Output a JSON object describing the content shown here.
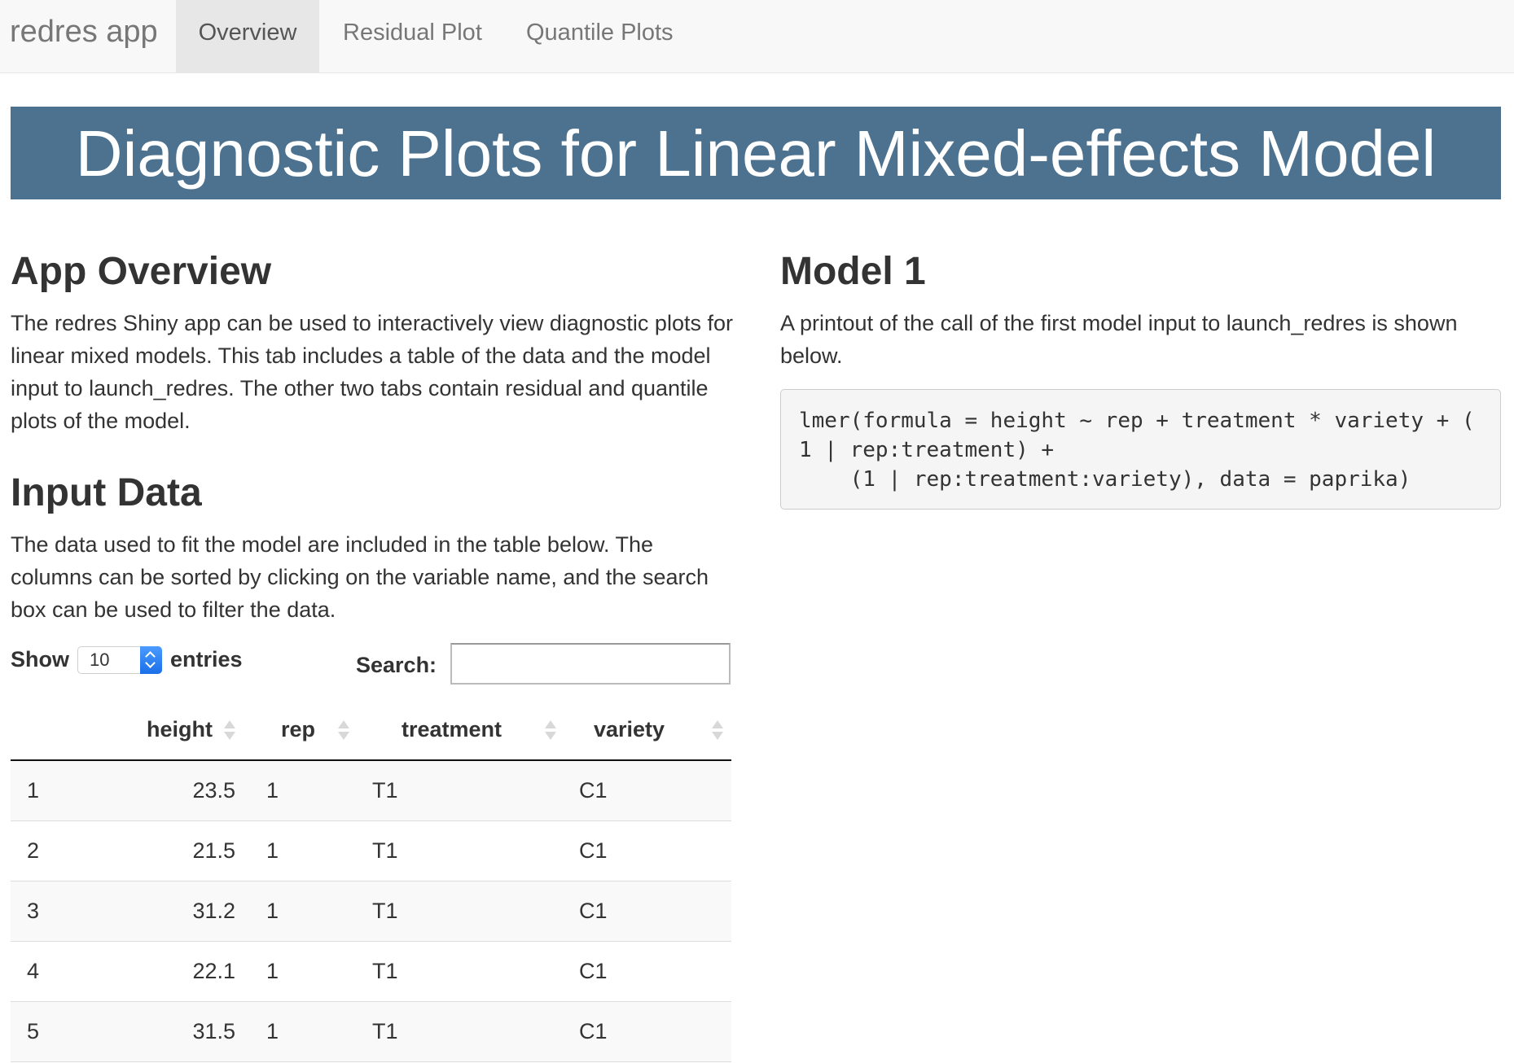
{
  "navbar": {
    "brand": "redres app",
    "tabs": [
      {
        "label": "Overview",
        "active": true
      },
      {
        "label": "Residual Plot",
        "active": false
      },
      {
        "label": "Quantile Plots",
        "active": false
      }
    ]
  },
  "banner": {
    "title": "Diagnostic Plots for Linear Mixed-effects Model"
  },
  "overview": {
    "heading": "App Overview",
    "text": "The redres Shiny app can be used to interactively view diagnostic plots for linear mixed models. This tab includes a table of the data and the model input to launch_redres. The other two tabs contain residual and quantile plots of the model."
  },
  "input_data": {
    "heading": "Input Data",
    "text": "The data used to fit the model are included in the table below. The columns can be sorted by clicking on the variable name, and the search box can be used to filter the data."
  },
  "model": {
    "heading": "Model 1",
    "text": "A printout of the call of the first model input to launch_redres is shown below.",
    "code": "lmer(formula = height ~ rep + treatment * variety + (\n1 | rep:treatment) +\n    (1 | rep:treatment:variety), data = paprika)"
  },
  "table_controls": {
    "show_label": "Show",
    "entries_value": "10",
    "entries_label": "entries",
    "search_label": "Search:",
    "search_value": ""
  },
  "table": {
    "columns": [
      "",
      "height",
      "rep",
      "treatment",
      "variety"
    ],
    "rows": [
      [
        "1",
        "23.5",
        "1",
        "T1",
        "C1"
      ],
      [
        "2",
        "21.5",
        "1",
        "T1",
        "C1"
      ],
      [
        "3",
        "31.2",
        "1",
        "T1",
        "C1"
      ],
      [
        "4",
        "22.1",
        "1",
        "T1",
        "C1"
      ],
      [
        "5",
        "31.5",
        "1",
        "T1",
        "C1"
      ]
    ]
  },
  "colors": {
    "banner": "#4d7290",
    "navbar": "#f8f8f8",
    "active_tab": "#e7e7e7",
    "select_arrow": "#1b6fe8"
  }
}
